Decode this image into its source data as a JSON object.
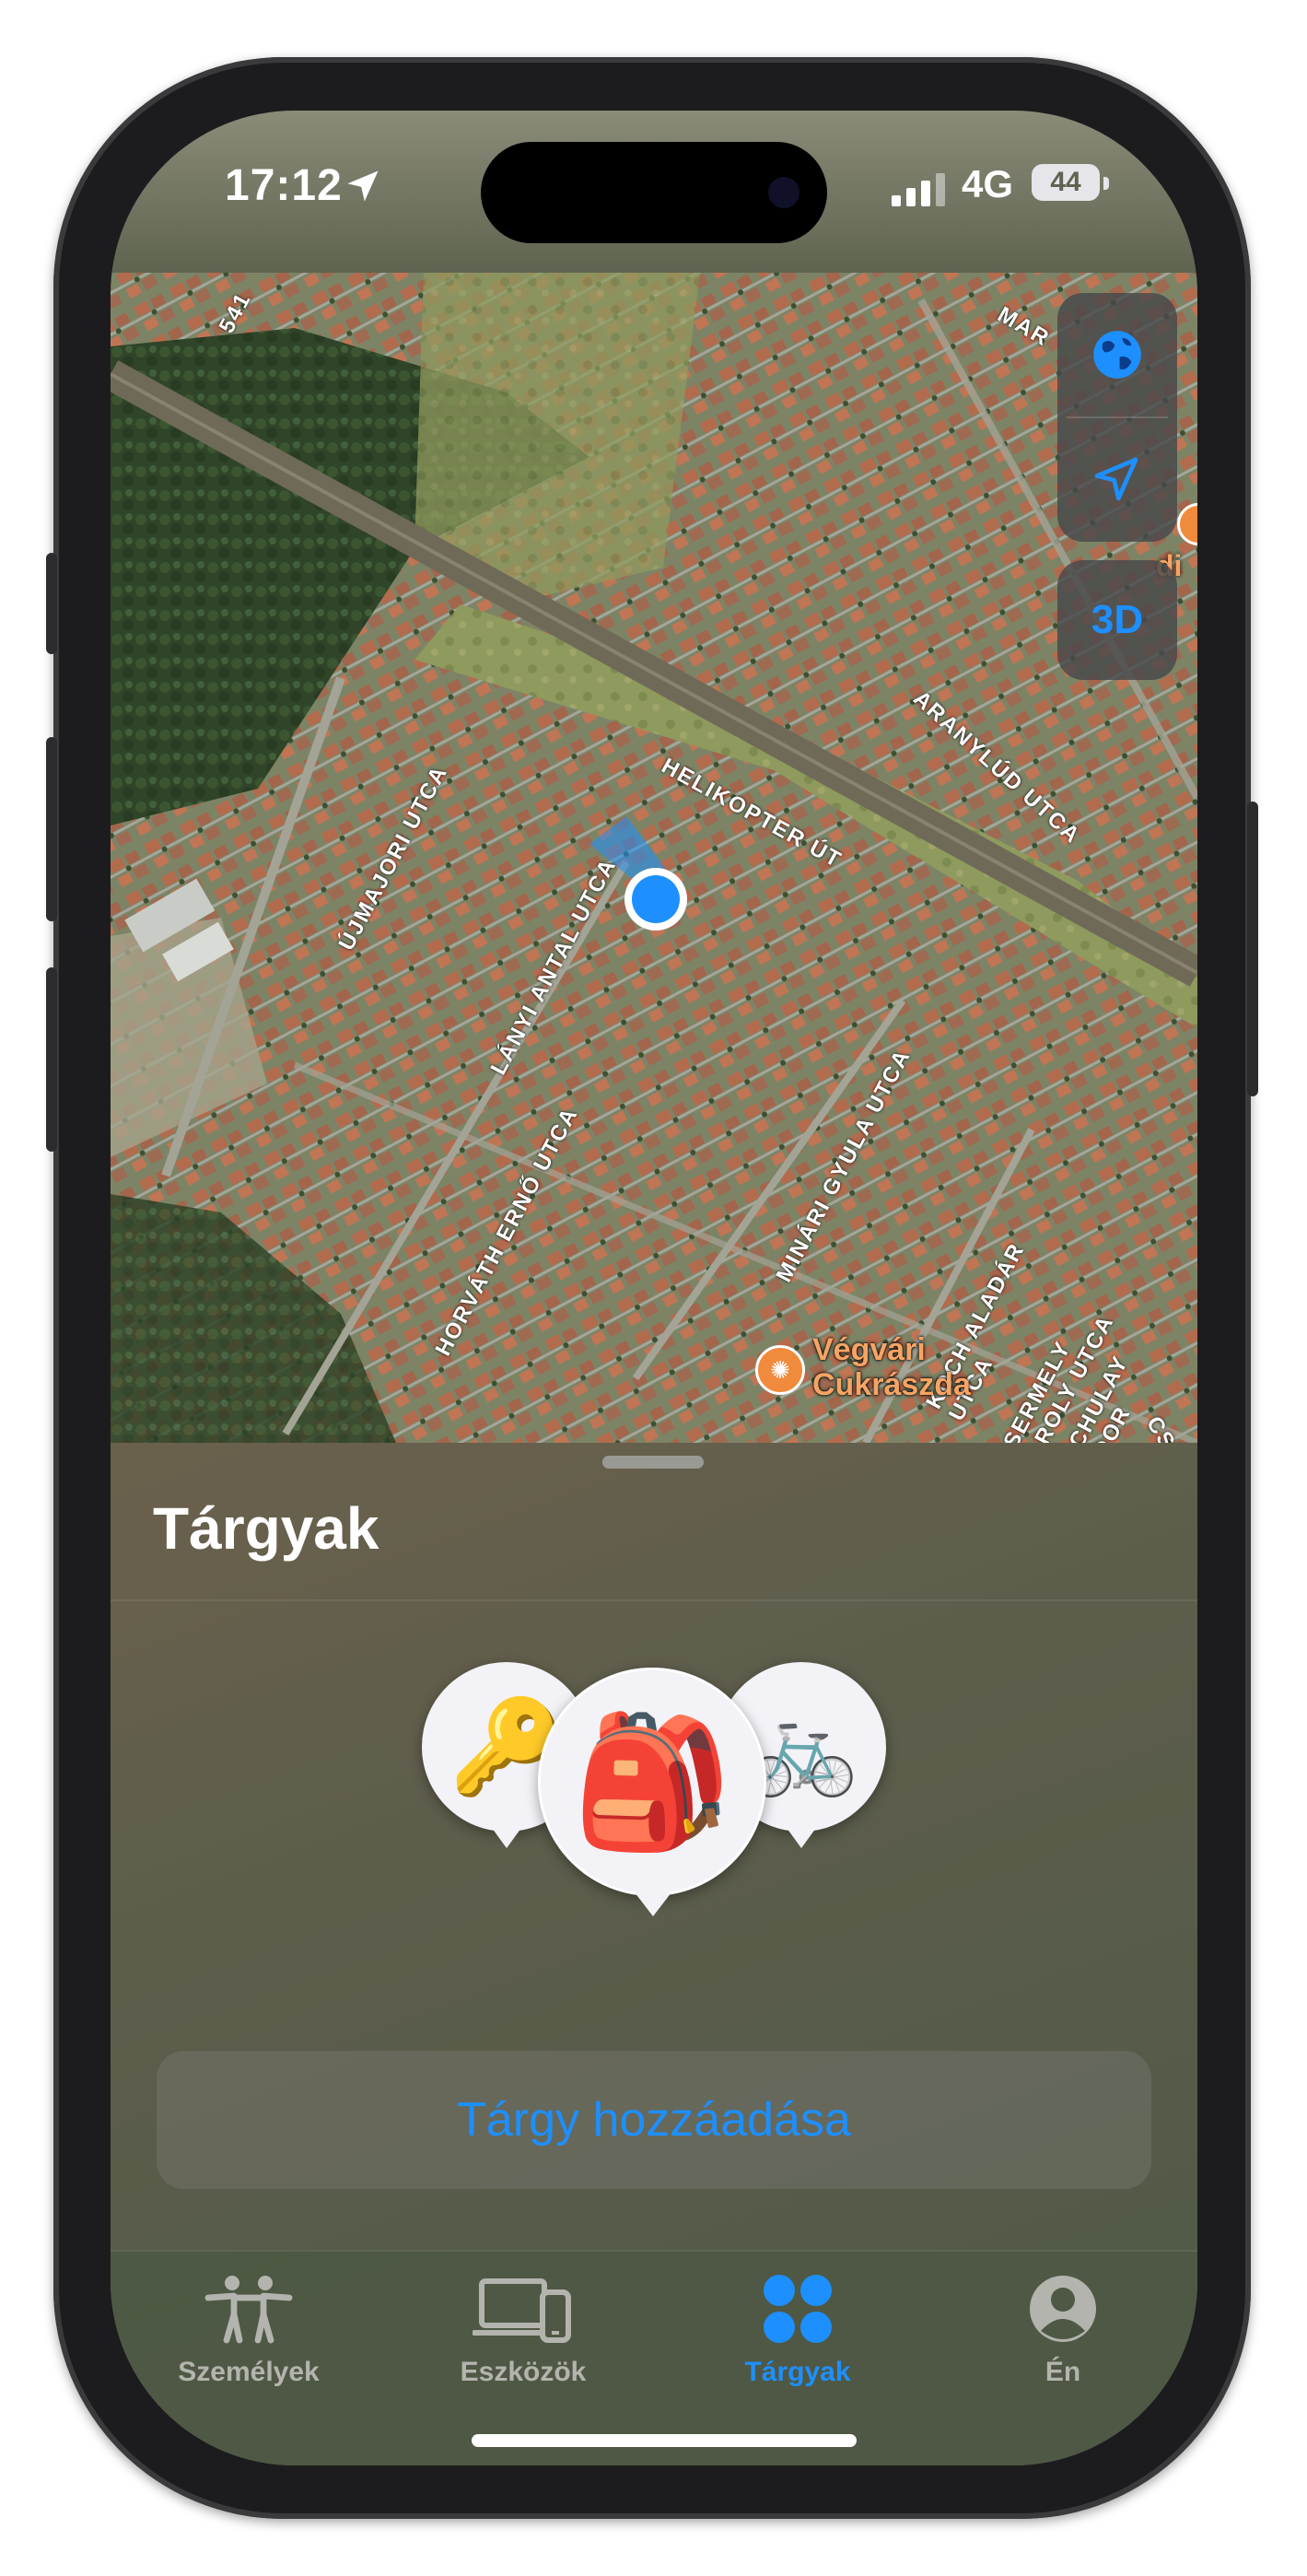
{
  "status_bar": {
    "time": "17:12",
    "network": "4G",
    "battery": "44"
  },
  "map": {
    "street_labels": [
      "HELIKOPTER ÚT",
      "ARANYLÚD UTCA",
      "ÚJMAJORI UTCA",
      "LÁNYI ANTAL UTCA",
      "HORVÁTH ERNŐ UTCA",
      "MINÁRI GYULA UTCA",
      "KOCH ALADÁR UTCA",
      "CSERMELY KÁROLY UTCA",
      "SVACHULAY SÁNDOR",
      "CSÍK",
      "MAR",
      "541"
    ],
    "poi_name_line1": "Végvári",
    "poi_name_line2": "Cukrászda",
    "poi_top_right_partial": "di",
    "controls": {
      "globe_icon": "globe-icon",
      "location_icon": "location-arrow-icon",
      "three_d_label": "3D"
    }
  },
  "sheet": {
    "title": "Tárgyak",
    "items": [
      {
        "name": "key",
        "emoji": "🔑"
      },
      {
        "name": "backpack",
        "emoji": "🎒"
      },
      {
        "name": "bicycle",
        "emoji": "🚲"
      }
    ],
    "add_button_label": "Tárgy hozzáadása"
  },
  "tab_bar": {
    "tabs": [
      {
        "label": "Személyek",
        "icon": "people-icon",
        "active": false
      },
      {
        "label": "Eszközök",
        "icon": "devices-icon",
        "active": false
      },
      {
        "label": "Tárgyak",
        "icon": "items-grid-icon",
        "active": true
      },
      {
        "label": "Én",
        "icon": "person-circle-icon",
        "active": false
      }
    ]
  },
  "colors": {
    "accent": "#1e8ffe",
    "inactive_tab": "#b4b4ae",
    "poi_orange": "#f08a3c"
  }
}
